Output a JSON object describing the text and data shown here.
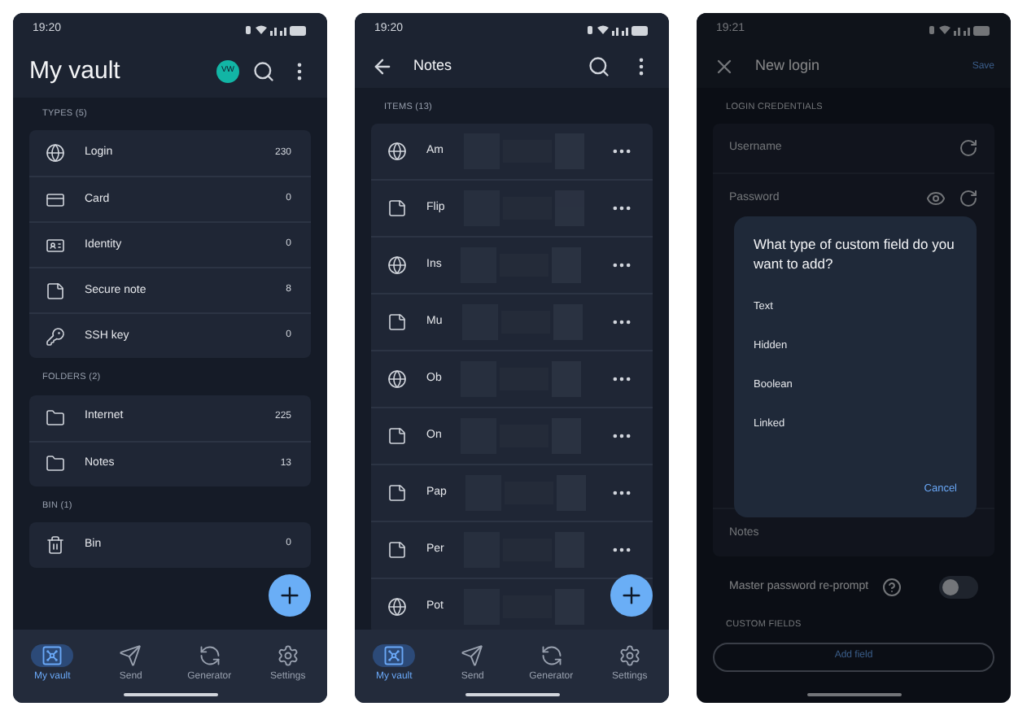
{
  "vault_screen": {
    "status_time": "19:20",
    "title": "My vault",
    "avatar": "VW",
    "sections": [
      {
        "label": "TYPES (5)",
        "items": [
          {
            "kind": "login",
            "label": "Login",
            "count": "230"
          },
          {
            "kind": "card",
            "label": "Card",
            "count": "0"
          },
          {
            "kind": "identity",
            "label": "Identity",
            "count": "0"
          },
          {
            "kind": "note",
            "label": "Secure note",
            "count": "8"
          },
          {
            "kind": "ssh",
            "label": "SSH key",
            "count": "0"
          }
        ]
      },
      {
        "label": "FOLDERS (2)",
        "items": [
          {
            "kind": "folder",
            "label": "Internet",
            "count": "225"
          },
          {
            "kind": "folder",
            "label": "Notes",
            "count": "13"
          }
        ]
      },
      {
        "label": "BIN (1)",
        "items": [
          {
            "kind": "bin",
            "label": "Bin",
            "count": "0"
          }
        ]
      }
    ],
    "nav": [
      {
        "label": "My vault",
        "selected": true
      },
      {
        "label": "Send",
        "selected": false
      },
      {
        "label": "Generator",
        "selected": false
      },
      {
        "label": "Settings",
        "selected": false
      }
    ]
  },
  "notes_screen": {
    "status_time": "19:20",
    "title": "Notes",
    "section_label": "ITEMS (13)",
    "items": [
      {
        "kind": "login",
        "label": "Am"
      },
      {
        "kind": "note",
        "label": "Flip"
      },
      {
        "kind": "login",
        "label": "Ins"
      },
      {
        "kind": "note",
        "label": "Mu"
      },
      {
        "kind": "login",
        "label": "Ob"
      },
      {
        "kind": "note",
        "label": "On"
      },
      {
        "kind": "note",
        "label": "Pap"
      },
      {
        "kind": "note",
        "label": "Per"
      },
      {
        "kind": "login",
        "label": "Pot"
      }
    ],
    "nav": [
      {
        "label": "My vault",
        "selected": true
      },
      {
        "label": "Send",
        "selected": false
      },
      {
        "label": "Generator",
        "selected": false
      },
      {
        "label": "Settings",
        "selected": false
      }
    ]
  },
  "new_login_screen": {
    "status_time": "19:21",
    "title": "New login",
    "save": "Save",
    "section_label": "LOGIN CREDENTIALS",
    "username_placeholder": "Username",
    "password_placeholder": "Password",
    "notes_placeholder": "Notes",
    "reprompt": {
      "label": "Master password re-prompt",
      "on": false
    },
    "custom_fields_label": "CUSTOM FIELDS",
    "add_field": "Add field",
    "dialog": {
      "title": "What type of custom field do you want to add?",
      "options": [
        "Text",
        "Hidden",
        "Boolean",
        "Linked"
      ],
      "cancel": "Cancel"
    }
  }
}
